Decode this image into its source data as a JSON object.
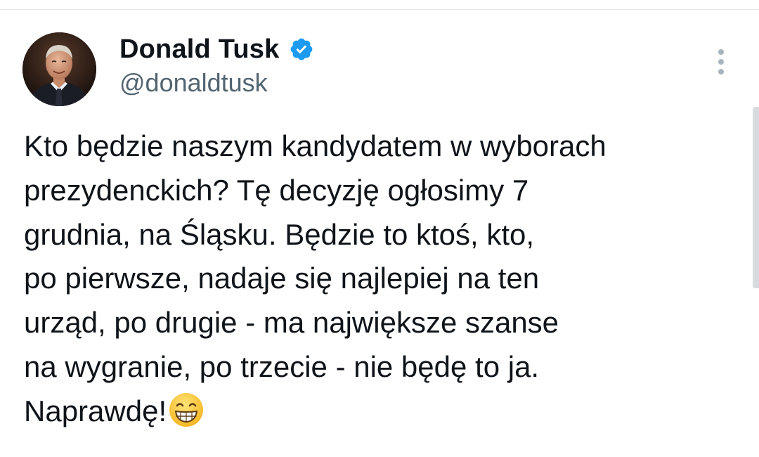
{
  "author": {
    "display_name": "Donald Tusk",
    "handle": "@donaldtusk",
    "verified": true,
    "verified_color": "#1d9bf0"
  },
  "tweet": {
    "lines": [
      "Kto będzie naszym kandydatem w wyborach",
      "prezydenckich? Tę decyzję ogłosimy 7",
      "grudnia, na Śląsku. Będzie to ktoś, kto,",
      "po pierwsze, nadaje się najlepiej na ten",
      "urząd, po drugie - ma największe szanse",
      "na wygranie, po trzecie - nie będę to ja.",
      "Naprawdę!"
    ],
    "trailing_emoji": "grinning-face-with-smiling-eyes"
  },
  "icons": {
    "verified": "verified-badge-icon",
    "more": "more-options-icon"
  },
  "colors": {
    "text": "#0f1419",
    "secondary_text": "#536471",
    "divider": "#e6e9ec"
  }
}
